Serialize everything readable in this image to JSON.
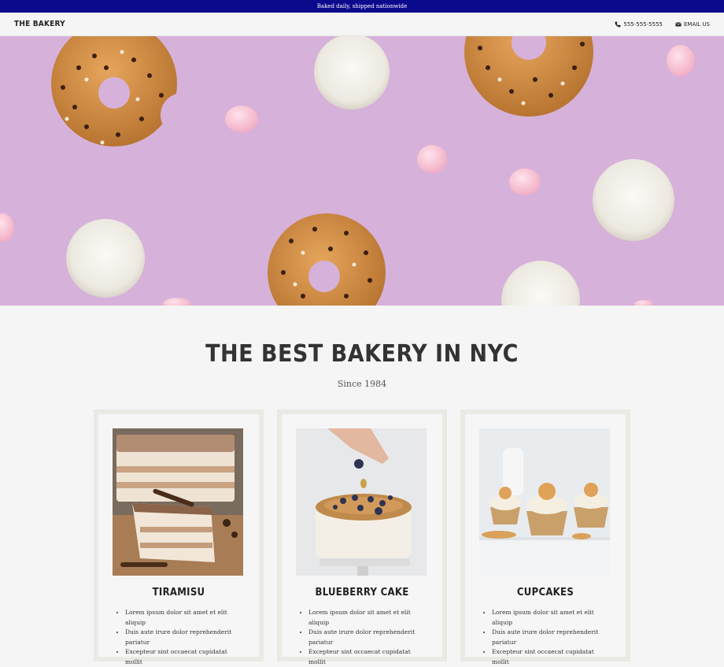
{
  "topbar": {
    "text": "Baked daily, shipped nationwide"
  },
  "nav": {
    "logo": "THE BAKERY",
    "phone": "555-555-5555",
    "email": "EMAIL US",
    "icons": [
      "phone-icon",
      "envelope-icon"
    ]
  },
  "hero": {
    "image": "donuts-and-meringues-on-pink-background"
  },
  "headline": {
    "title": "THE BEST BAKERY IN NYC",
    "subtitle": "Since 1984"
  },
  "cards": [
    {
      "title": "TIRAMISU",
      "image": "tiramisu-cake-slice",
      "items": [
        "Lorem ipsum dolor sit amet et elit aliquip",
        "Duis aute irure dolor reprehenderit pariatur",
        "Excepteur sint occaecat cupidatat mollit"
      ]
    },
    {
      "title": "BLUEBERRY CAKE",
      "image": "blueberry-cake",
      "items": [
        "Lorem ipsum dolor sit amet et elit aliquip",
        "Duis aute irure dolor reprehenderit pariatur",
        "Excepteur sint occaecat cupidatat mollit"
      ]
    },
    {
      "title": "CUPCAKES",
      "image": "cupcakes",
      "items": [
        "Lorem ipsum dolor sit amet et elit aliquip",
        "Duis aute irure dolor reprehenderit pariatur",
        "Excepteur sint occaecat cupidatat mollit"
      ]
    }
  ],
  "colors": {
    "topbar_bg": "#0c0a8c",
    "page_bg": "#f5f5f5",
    "card_border": "#e8eae4",
    "hero_bg": "#d4afd8"
  }
}
